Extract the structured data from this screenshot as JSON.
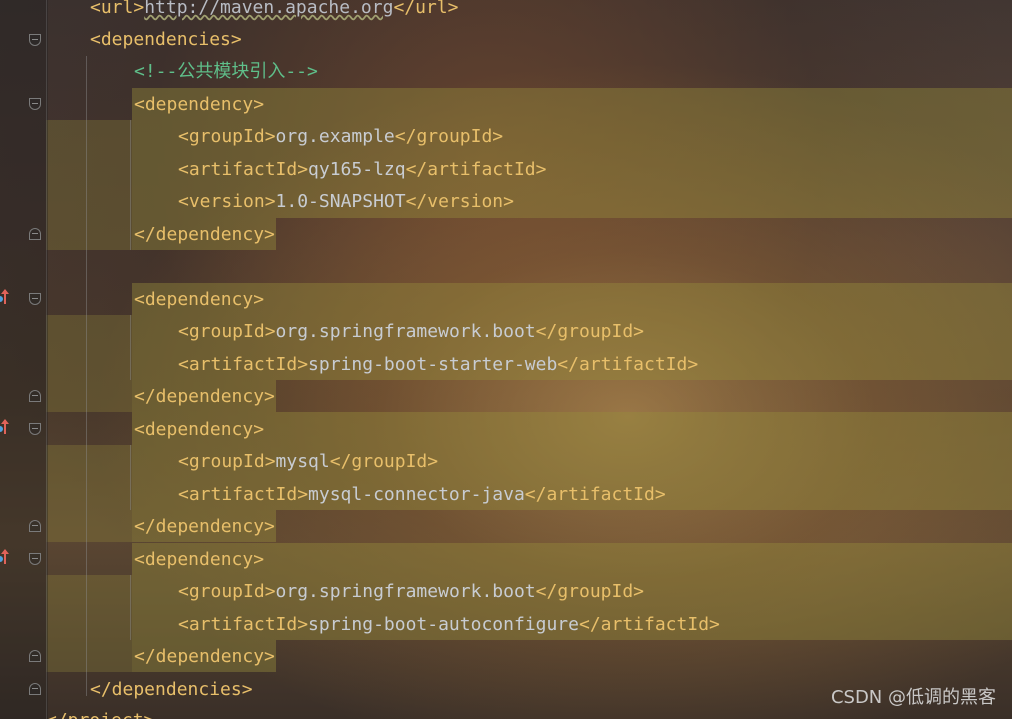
{
  "editor": {
    "lines": [
      {
        "open": "<url>",
        "link": "http://maven.apache.org",
        "close": "</url>"
      },
      {
        "tag": "<dependencies>"
      },
      {
        "comment": "<!--公共模块引入-->"
      },
      {
        "tag": "<dependency>"
      },
      {
        "open": "<groupId>",
        "value": "org.example",
        "close": "</groupId>"
      },
      {
        "open": "<artifactId>",
        "value": "qy165-lzq",
        "close": "</artifactId>"
      },
      {
        "open": "<version>",
        "value": "1.0-SNAPSHOT",
        "close": "</version>"
      },
      {
        "tag": "</dependency>"
      },
      {
        "tag": ""
      },
      {
        "tag": "<dependency>"
      },
      {
        "open": "<groupId>",
        "value": "org.springframework.boot",
        "close": "</groupId>"
      },
      {
        "open": "<artifactId>",
        "value": "spring-boot-starter-web",
        "close": "</artifactId>"
      },
      {
        "tag": "</dependency>"
      },
      {
        "tag": "<dependency>"
      },
      {
        "open": "<groupId>",
        "value": "mysql",
        "close": "</groupId>"
      },
      {
        "open": "<artifactId>",
        "value": "mysql-connector-java",
        "close": "</artifactId>"
      },
      {
        "tag": "</dependency>"
      },
      {
        "tag": "<dependency>"
      },
      {
        "open": "<groupId>",
        "value": "org.springframework.boot",
        "close": "</groupId>"
      },
      {
        "open": "<artifactId>",
        "value": "spring-boot-autoconfigure",
        "close": "</artifactId>"
      },
      {
        "tag": "</dependency>"
      },
      {
        "tag": "</dependencies>"
      },
      {
        "tag": "</project>"
      }
    ]
  },
  "watermark": "CSDN @低调的黑客",
  "colors": {
    "tag": "#e8bf6a",
    "text": "#c8ccd2",
    "comment": "#5fbf8a",
    "highlight": "#968c3c",
    "vcs_marker": "#e0635a"
  },
  "icons": {
    "fold": "fold-toggle-icon",
    "vcs": "vcs-change-marker-icon"
  }
}
